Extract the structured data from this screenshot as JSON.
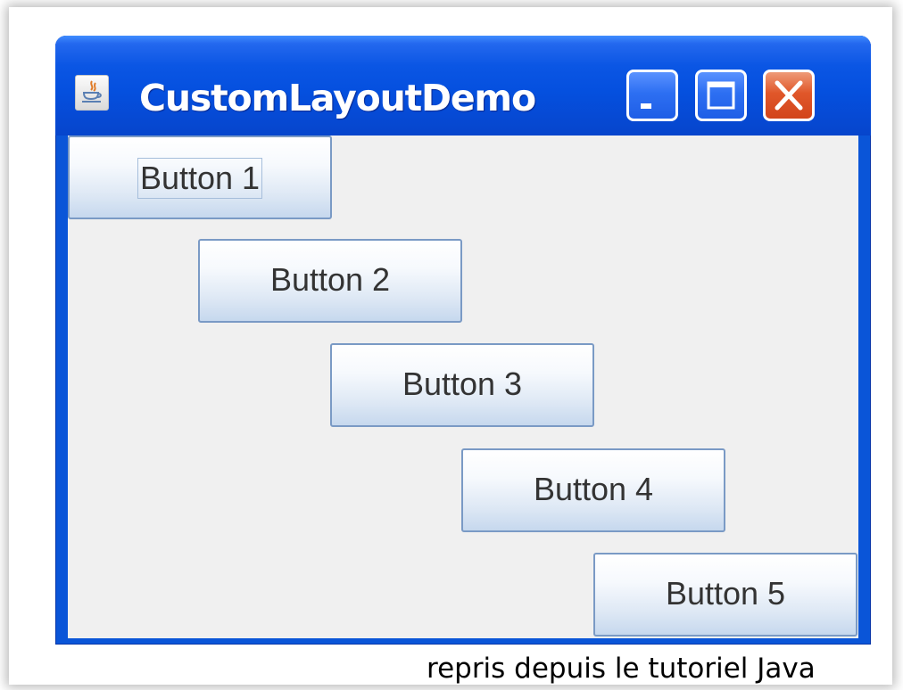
{
  "window": {
    "title": "CustomLayoutDemo",
    "controls": {
      "minimize_icon": "minimize-icon",
      "maximize_icon": "maximize-icon",
      "close_icon": "close-icon"
    },
    "colors": {
      "titlebar": "#0550df",
      "close_button": "#e0572a",
      "content_background": "#f0f0f0"
    }
  },
  "buttons": [
    {
      "label": "Button 1"
    },
    {
      "label": "Button 2"
    },
    {
      "label": "Button 3"
    },
    {
      "label": "Button 4"
    },
    {
      "label": "Button 5"
    }
  ],
  "caption": "repris depuis le tutoriel Java"
}
